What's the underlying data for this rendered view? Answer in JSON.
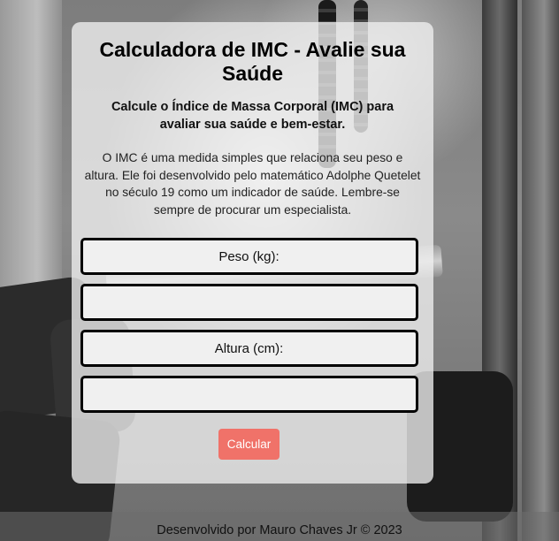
{
  "card": {
    "title": "Calculadora de IMC - Avalie sua Saúde",
    "subtitle": "Calcule o Índice de Massa Corporal (IMC) para avaliar sua saúde e bem-estar.",
    "description": "O IMC é uma medida simples que relaciona seu peso e altura. Ele foi desenvolvido pelo matemático Adolphe Quetelet no século 19 como um indicador de saúde. Lembre-se sempre de procurar um especialista."
  },
  "form": {
    "weight_label": "Peso (kg):",
    "weight_value": "",
    "height_label": "Altura (cm):",
    "height_value": "",
    "calculate_label": "Calcular"
  },
  "footer": {
    "text": "Desenvolvido por Mauro Chaves Jr © 2023"
  },
  "colors": {
    "button": "#f07269",
    "card_background": "#f0f0f0",
    "field_border": "#000000"
  }
}
